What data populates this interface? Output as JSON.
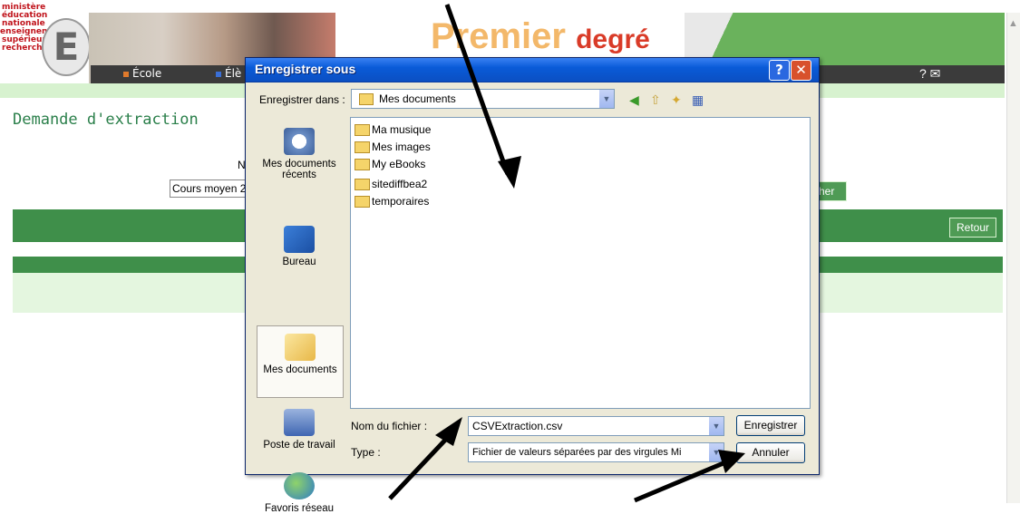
{
  "site": {
    "logo_lines": [
      "ministère",
      "éducation",
      "nationale",
      "enseignement",
      "supérieur",
      "recherche"
    ],
    "logo_letter": "E",
    "banner_title_a": "Premier",
    "banner_title_b": "degré",
    "nav": [
      {
        "label": "École",
        "color": "#e07a2c"
      },
      {
        "label": "Élè",
        "color": "#3a6fd6"
      }
    ],
    "help_icons": "?  ✉",
    "page_heading": "Demande d'extraction",
    "field_label": "N",
    "cours_value": "Cours moyen 2",
    "partial_button": "her",
    "retour_button": "Retour",
    "green": "#3f8f4a"
  },
  "dialog": {
    "title": "Enregistrer sous",
    "help_glyph": "?",
    "close_glyph": "✕",
    "lookin_label": "Enregistrer dans :",
    "lookin_value": "Mes documents",
    "toolbar_icons": [
      "back-icon",
      "up-folder-icon",
      "new-folder-icon",
      "views-icon"
    ],
    "places": [
      {
        "label": "Mes documents récents",
        "icon": "recent-docs-icon"
      },
      {
        "label": "Bureau",
        "icon": "desktop-icon"
      },
      {
        "label": "Mes documents",
        "icon": "my-docs-icon",
        "selected": true
      },
      {
        "label": "Poste de travail",
        "icon": "computer-icon"
      },
      {
        "label": "Favoris réseau",
        "icon": "network-icon"
      }
    ],
    "files": [
      "Ma musique",
      "Mes images",
      "My eBooks",
      "sitediffbea2",
      "temporaires"
    ],
    "filename_label": "Nom du fichier :",
    "filename_value": "CSVExtraction.csv",
    "type_label": "Type :",
    "type_value": "Fichier de valeurs séparées par des virgules Mi",
    "save_button": "Enregistrer",
    "cancel_button": "Annuler",
    "title_color": "#0a5bd8"
  }
}
